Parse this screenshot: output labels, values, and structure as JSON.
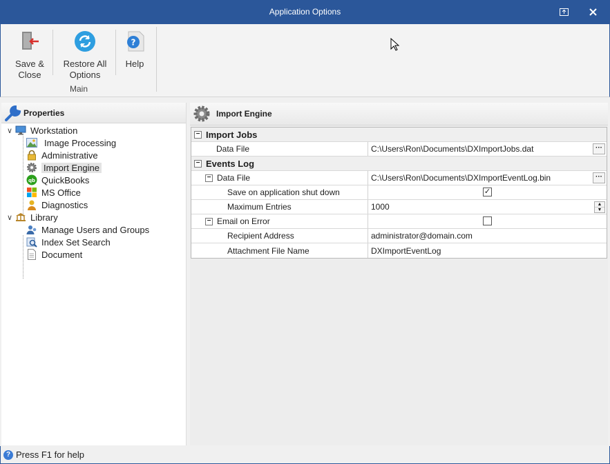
{
  "window": {
    "title": "Application Options"
  },
  "ribbon": {
    "save_close_line1": "Save &",
    "save_close_line2": "Close",
    "restore_line1": "Restore All",
    "restore_line2": "Options",
    "help": "Help",
    "group_label": "Main"
  },
  "left_panel": {
    "header": "Properties",
    "tree": {
      "workstation": "Workstation",
      "image_processing": "Image Processing",
      "administrative": "Administrative",
      "import_engine": "Import Engine",
      "quickbooks": "QuickBooks",
      "ms_office": "MS Office",
      "diagnostics": "Diagnostics",
      "library": "Library",
      "manage_users": "Manage Users and Groups",
      "index_set_search": "Index Set Search",
      "document": "Document"
    },
    "selected": "Import Engine"
  },
  "right_panel": {
    "header": "Import Engine",
    "categories": {
      "import_jobs": "Import Jobs",
      "events_log": "Events Log"
    },
    "rows": {
      "ij_data_file_name": "Data File",
      "ij_data_file_value": "C:\\Users\\Ron\\Documents\\DXImportJobs.dat",
      "el_data_file_name": "Data File",
      "el_data_file_value": "C:\\Users\\Ron\\Documents\\DXImportEventLog.bin",
      "save_on_shutdown_name": "Save on application shut down",
      "save_on_shutdown_value": true,
      "max_entries_name": "Maximum Entries",
      "max_entries_value": "1000",
      "email_on_error_name": "Email on Error",
      "email_on_error_value": false,
      "recipient_name": "Recipient Address",
      "recipient_value": "administrator@domain.com",
      "attachment_name": "Attachment File Name",
      "attachment_value": "DXImportEventLog"
    }
  },
  "status": {
    "text": "Press F1 for help"
  },
  "colors": {
    "titlebar": "#2b579a",
    "accent": "#3a7bd5"
  }
}
